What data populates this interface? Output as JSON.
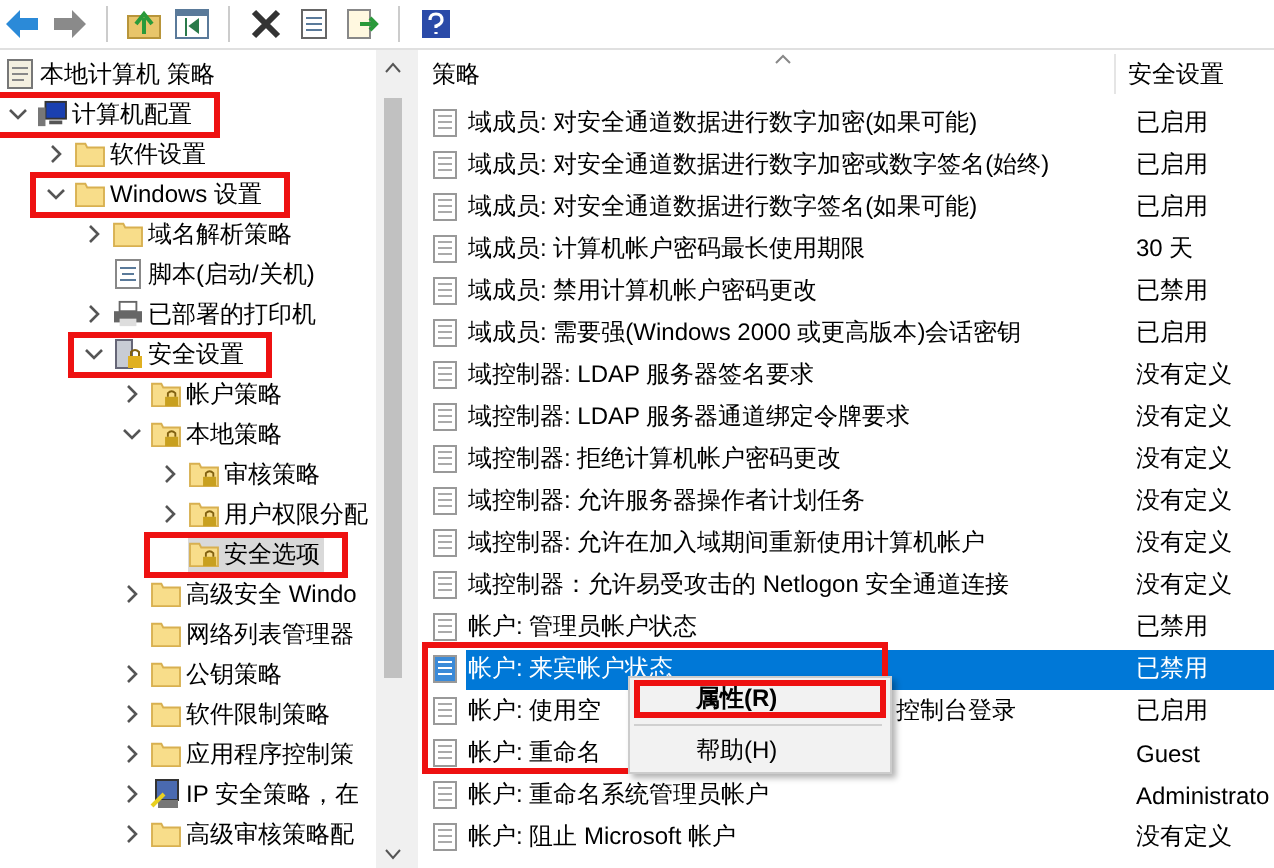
{
  "toolbar": {
    "buttons": [
      {
        "kind": "back",
        "disabled": false
      },
      {
        "kind": "forward",
        "disabled": true
      },
      {
        "kind": "sep"
      },
      {
        "kind": "up"
      },
      {
        "kind": "tree"
      },
      {
        "kind": "sep"
      },
      {
        "kind": "delete"
      },
      {
        "kind": "properties"
      },
      {
        "kind": "export"
      },
      {
        "kind": "sep"
      },
      {
        "kind": "help"
      }
    ]
  },
  "tree": [
    {
      "label": "本地计算机 策略",
      "kind": "doc",
      "highlighted": false,
      "selected": false,
      "children": [
        {
          "label": "计算机配置",
          "kind": "computer",
          "expanded": true,
          "highlighted": true,
          "selected": false,
          "children": [
            {
              "label": "软件设置",
              "kind": "folder",
              "expanded": false,
              "highlighted": false,
              "selected": false
            },
            {
              "label": "Windows 设置",
              "kind": "folder",
              "expanded": true,
              "highlighted": true,
              "selected": false,
              "children": [
                {
                  "label": "域名解析策略",
                  "kind": "folder",
                  "expanded": false,
                  "highlighted": false,
                  "selected": false
                },
                {
                  "label": "脚本(启动/关机)",
                  "kind": "script",
                  "highlighted": false,
                  "selected": false
                },
                {
                  "label": "已部署的打印机",
                  "kind": "printer",
                  "expanded": false,
                  "highlighted": false,
                  "selected": false
                },
                {
                  "label": "安全设置",
                  "kind": "security",
                  "expanded": true,
                  "highlighted": true,
                  "selected": false,
                  "children": [
                    {
                      "label": "帐户策略",
                      "kind": "locked-folder",
                      "expanded": false,
                      "highlighted": false,
                      "selected": false
                    },
                    {
                      "label": "本地策略",
                      "kind": "locked-folder",
                      "expanded": true,
                      "highlighted": false,
                      "selected": false,
                      "children": [
                        {
                          "label": "审核策略",
                          "kind": "locked-folder",
                          "expanded": false,
                          "highlighted": false,
                          "selected": false
                        },
                        {
                          "label": "用户权限分配",
                          "kind": "locked-folder",
                          "expanded": false,
                          "highlighted": false,
                          "selected": false
                        },
                        {
                          "label": "安全选项",
                          "kind": "locked-folder",
                          "highlighted": true,
                          "selected": true
                        }
                      ]
                    },
                    {
                      "label": "高级安全 Windo",
                      "kind": "folder",
                      "expanded": false,
                      "highlighted": false,
                      "selected": false
                    },
                    {
                      "label": "网络列表管理器",
                      "kind": "folder",
                      "highlighted": false,
                      "selected": false
                    },
                    {
                      "label": "公钥策略",
                      "kind": "folder",
                      "expanded": false,
                      "highlighted": false,
                      "selected": false
                    },
                    {
                      "label": "软件限制策略",
                      "kind": "folder",
                      "expanded": false,
                      "highlighted": false,
                      "selected": false
                    },
                    {
                      "label": "应用程序控制策",
                      "kind": "folder",
                      "expanded": false,
                      "highlighted": false,
                      "selected": false
                    },
                    {
                      "label": "IP 安全策略，在",
                      "kind": "ip",
                      "expanded": false,
                      "highlighted": false,
                      "selected": false
                    },
                    {
                      "label": "高级审核策略配",
                      "kind": "folder",
                      "expanded": false,
                      "highlighted": false,
                      "selected": false
                    }
                  ]
                }
              ]
            }
          ]
        }
      ]
    }
  ],
  "list": {
    "columns": [
      "策略",
      "安全设置"
    ],
    "rows": [
      {
        "name": "域成员: 对安全通道数据进行数字加密(如果可能)",
        "setting": "已启用",
        "selected": false,
        "highlighted": false
      },
      {
        "name": "域成员: 对安全通道数据进行数字加密或数字签名(始终)",
        "setting": "已启用",
        "selected": false,
        "highlighted": false
      },
      {
        "name": "域成员: 对安全通道数据进行数字签名(如果可能)",
        "setting": "已启用",
        "selected": false,
        "highlighted": false
      },
      {
        "name": "域成员: 计算机帐户密码最长使用期限",
        "setting": "30 天",
        "selected": false,
        "highlighted": false
      },
      {
        "name": "域成员: 禁用计算机帐户密码更改",
        "setting": "已禁用",
        "selected": false,
        "highlighted": false
      },
      {
        "name": "域成员: 需要强(Windows 2000 或更高版本)会话密钥",
        "setting": "已启用",
        "selected": false,
        "highlighted": false
      },
      {
        "name": "域控制器: LDAP 服务器签名要求",
        "setting": "没有定义",
        "selected": false,
        "highlighted": false
      },
      {
        "name": "域控制器: LDAP 服务器通道绑定令牌要求",
        "setting": "没有定义",
        "selected": false,
        "highlighted": false
      },
      {
        "name": "域控制器: 拒绝计算机帐户密码更改",
        "setting": "没有定义",
        "selected": false,
        "highlighted": false
      },
      {
        "name": "域控制器: 允许服务器操作者计划任务",
        "setting": "没有定义",
        "selected": false,
        "highlighted": false
      },
      {
        "name": "域控制器:  允许在加入域期间重新使用计算机帐户",
        "setting": "没有定义",
        "selected": false,
        "highlighted": false
      },
      {
        "name": "域控制器：允许易受攻击的 Netlogon 安全通道连接",
        "setting": "没有定义",
        "selected": false,
        "highlighted": false
      },
      {
        "name": "帐户: 管理员帐户状态",
        "setting": "已禁用",
        "selected": false,
        "highlighted": false
      },
      {
        "name": "帐户: 来宾帐户状态",
        "setting": "已禁用",
        "selected": true,
        "highlighted": true
      },
      {
        "name": "帐户: 使用空",
        "name_tail": "控制台登录",
        "setting": "已启用",
        "selected": false,
        "highlighted": true
      },
      {
        "name": "帐户: 重命名",
        "setting": "Guest",
        "selected": false,
        "highlighted": true
      },
      {
        "name": "帐户: 重命名系统管理员帐户",
        "setting": "Administrato",
        "selected": false,
        "highlighted": false
      },
      {
        "name": "帐户: 阻止 Microsoft 帐户",
        "setting": "没有定义",
        "selected": false,
        "highlighted": false
      }
    ]
  },
  "context_menu": {
    "items": [
      {
        "kind": "item",
        "label": "属性(R)",
        "bold": true,
        "highlighted": true
      },
      {
        "kind": "separator"
      },
      {
        "kind": "item",
        "label": "帮助(H)",
        "bold": false,
        "highlighted": false
      }
    ]
  }
}
